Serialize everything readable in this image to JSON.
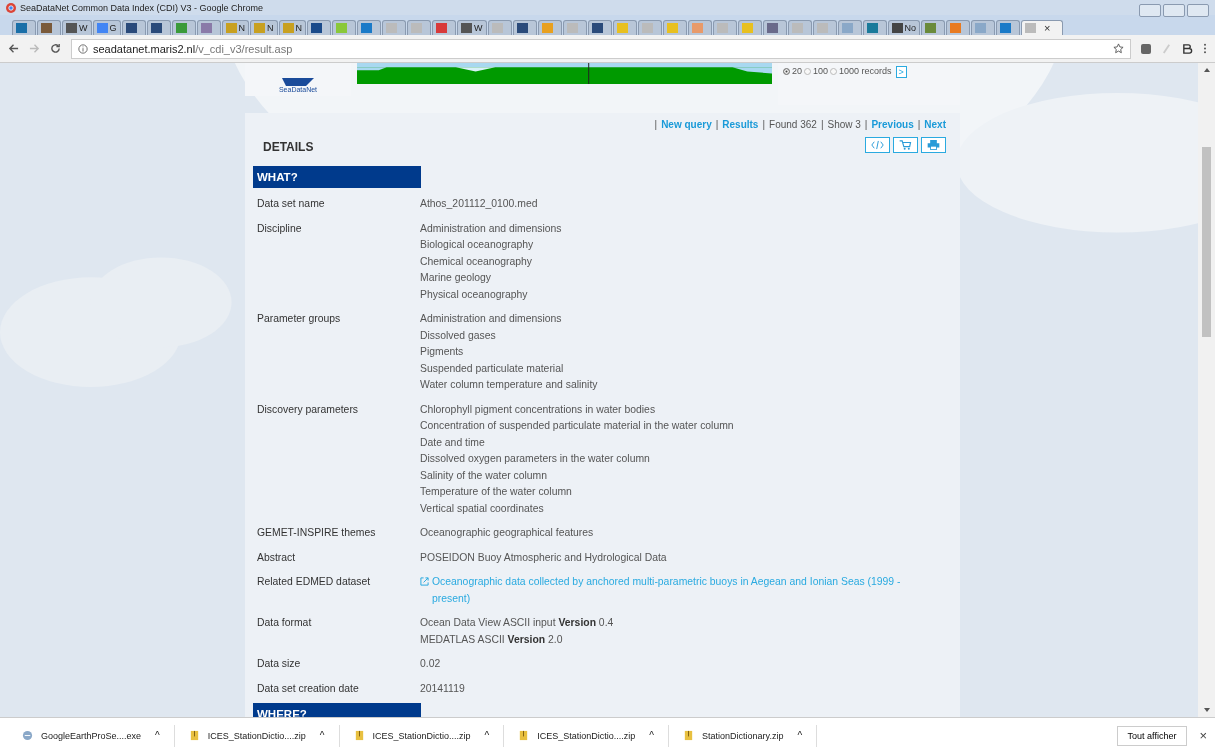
{
  "window": {
    "title": "SeaDataNet Common Data Index (CDI) V3 - Google Chrome"
  },
  "tabs": [
    {
      "color": "#1a6fa8",
      "selected": false
    },
    {
      "color": "#7a5a3a",
      "selected": false
    },
    {
      "label": "W",
      "color": "#555555",
      "selected": false
    },
    {
      "label": "G",
      "color": "#4285f4",
      "selected": false
    },
    {
      "color": "#2a4a7a",
      "selected": false
    },
    {
      "color": "#2a4a7a",
      "selected": false
    },
    {
      "color": "#3a9a3a",
      "selected": false
    },
    {
      "color": "#8a7aa8",
      "selected": false
    },
    {
      "label": "N",
      "color": "#c8a020",
      "selected": false
    },
    {
      "label": "N",
      "color": "#c8a020",
      "selected": false
    },
    {
      "label": "N",
      "color": "#c8a020",
      "selected": false
    },
    {
      "color": "#1a4a8a",
      "selected": false
    },
    {
      "color": "#8ac83a",
      "selected": false
    },
    {
      "color": "#1a7ac8",
      "selected": false
    },
    {
      "color": "#bbbbbb",
      "selected": false
    },
    {
      "color": "#bbbbbb",
      "selected": false
    },
    {
      "color": "#d83a3a",
      "selected": false
    },
    {
      "label": "W",
      "color": "#555555",
      "selected": false
    },
    {
      "color": "#bbbbbb",
      "selected": false
    },
    {
      "color": "#2a4a7a",
      "selected": false
    },
    {
      "color": "#e8a020",
      "selected": false
    },
    {
      "color": "#bbbbbb",
      "selected": false
    },
    {
      "color": "#2a4a7a",
      "selected": false
    },
    {
      "color": "#e8c020",
      "selected": false
    },
    {
      "color": "#bbbbbb",
      "selected": false
    },
    {
      "color": "#e8c020",
      "selected": false
    },
    {
      "color": "#e89a6a",
      "selected": false
    },
    {
      "color": "#bbbbbb",
      "selected": false
    },
    {
      "color": "#e8c020",
      "selected": false
    },
    {
      "color": "#6a6a8a",
      "selected": false
    },
    {
      "color": "#bbbbbb",
      "selected": false
    },
    {
      "color": "#bbbbbb",
      "selected": false
    },
    {
      "color": "#8aa8c8",
      "selected": false
    },
    {
      "color": "#1a7a9a",
      "selected": false
    },
    {
      "label": "No",
      "color": "#444444",
      "selected": false
    },
    {
      "color": "#6a8a3a",
      "selected": false
    },
    {
      "color": "#e87a20",
      "selected": false
    },
    {
      "color": "#8aa8c8",
      "selected": false
    },
    {
      "color": "#1a7ac8",
      "selected": false
    },
    {
      "color": "#bbbbbb",
      "selected": true
    }
  ],
  "tab_close": "×",
  "address": {
    "host": "seadatanet.maris2.nl",
    "path": "/v_cdi_v3/result.asp"
  },
  "header": {
    "logo_text": "SeaDataNet",
    "page_sizes": [
      {
        "label": "20",
        "selected": true
      },
      {
        "label": "100",
        "selected": false
      },
      {
        "label": "1000 records",
        "selected": false
      }
    ],
    "go": ">"
  },
  "nav_separator": "|",
  "nav": [
    {
      "text": "New query",
      "kind": "link"
    },
    {
      "text": "Results",
      "kind": "link"
    },
    {
      "text": "Found 362",
      "kind": "text"
    },
    {
      "text": "Show 3",
      "kind": "text"
    },
    {
      "text": "Previous",
      "kind": "link"
    },
    {
      "text": "Next",
      "kind": "link"
    }
  ],
  "details_title": "DETAILS",
  "sections": [
    {
      "title": "WHAT?",
      "rows": [
        {
          "label": "Data set name",
          "values": [
            "Athos_201112_0100.med"
          ]
        },
        {
          "label": "Discipline",
          "values": [
            "Administration and dimensions",
            "Biological oceanography",
            "Chemical oceanography",
            "Marine geology",
            "Physical oceanography"
          ]
        },
        {
          "label": "Parameter groups",
          "values": [
            "Administration and dimensions",
            "Dissolved gases",
            "Pigments",
            "Suspended particulate material",
            "Water column temperature and salinity"
          ]
        },
        {
          "label": "Discovery parameters",
          "values": [
            "Chlorophyll pigment concentrations in water bodies",
            "Concentration of suspended particulate material in the water column",
            "Date and time",
            "Dissolved oxygen parameters in the water column",
            "Salinity of the water column",
            "Temperature of the water column",
            "Vertical spatial coordinates"
          ]
        },
        {
          "label": "GEMET-INSPIRE themes",
          "values": [
            "Oceanographic geographical features"
          ]
        },
        {
          "label": "Abstract",
          "values": [
            "POSEIDON Buoy Atmospheric and Hydrological Data"
          ]
        },
        {
          "label": "Related EDMED dataset",
          "link": "Oceanographic data collected by anchored multi-parametric buoys in Aegean and Ionian Seas (1999 - present)"
        },
        {
          "label": "Data format",
          "values": [
            "Ocean Data View ASCII input  **Version** 0.4",
            "MEDATLAS ASCII  **Version** 2.0"
          ]
        },
        {
          "label": "Data size",
          "values": [
            "0.02"
          ]
        },
        {
          "label": "Data set creation date",
          "values": [
            "20141119"
          ]
        }
      ]
    },
    {
      "title": "WHERE?"
    }
  ],
  "downloads": [
    {
      "name": "GoogleEarthProSe....exe",
      "kind": "exe"
    },
    {
      "name": "ICES_StationDictio....zip",
      "kind": "zip"
    },
    {
      "name": "ICES_StationDictio....zip",
      "kind": "zip"
    },
    {
      "name": "ICES_StationDictio....zip",
      "kind": "zip"
    },
    {
      "name": "StationDictionary.zip",
      "kind": "zip"
    }
  ],
  "show_all": "Tout afficher",
  "close": "×",
  "caret": "^"
}
